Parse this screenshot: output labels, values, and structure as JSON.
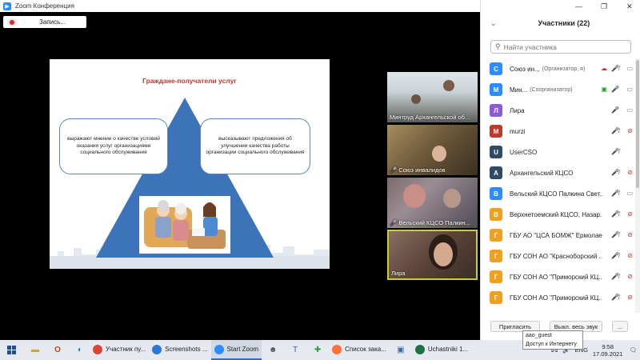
{
  "window": {
    "title": "Zoom Конференция"
  },
  "recording": {
    "label": "Запись..."
  },
  "slide": {
    "title": "Граждане-получатели услуг",
    "left_text": "выражают мнение о качестве условий оказания услуг организациями социального обслуживания",
    "right_text": "высказывают предложения об улучшении качества работы организации социального обслуживания"
  },
  "videos": [
    {
      "name": "Минтруд Архангельской об...",
      "muted": false
    },
    {
      "name": "Союз инвалидов",
      "muted": true
    },
    {
      "name": "Вельский КЦСО Палкин...",
      "muted": true
    },
    {
      "name": "Лира",
      "muted": false
    }
  ],
  "panel": {
    "title": "Участники (22)",
    "search_placeholder": "Найти участника",
    "participants": [
      {
        "initial": "С",
        "color": "#2d8cff",
        "name": "Союз ин...",
        "tag": "(Организатор, я)",
        "mic": "muted",
        "cam": "on",
        "extra": "cloud"
      },
      {
        "initial": "М",
        "color": "#2d8cff",
        "name": "Мин...",
        "tag": "(Соорганизатор)",
        "mic": "on",
        "cam": "on",
        "extra": "share"
      },
      {
        "initial": "Л",
        "color": "#8e5bd6",
        "name": "Лира",
        "tag": "",
        "mic": "on",
        "cam": "on",
        "extra": ""
      },
      {
        "initial": "M",
        "color": "#c0392b",
        "name": "murzi",
        "tag": "",
        "mic": "muted",
        "cam": "off",
        "extra": ""
      },
      {
        "initial": "U",
        "color": "#2f4b66",
        "name": "UserCSO",
        "tag": "",
        "mic": "muted",
        "cam": "",
        "extra": ""
      },
      {
        "initial": "А",
        "color": "#2f4b66",
        "name": "Архангельский КЦСО",
        "tag": "",
        "mic": "muted",
        "cam": "off",
        "extra": ""
      },
      {
        "initial": "В",
        "color": "#2d8cff",
        "name": "Вельский КЦСО Палкина Свет...",
        "tag": "",
        "mic": "muted",
        "cam": "on",
        "extra": ""
      },
      {
        "initial": "В",
        "color": "#f0a020",
        "name": "Верхнетоемский КЦСО, Назар...",
        "tag": "",
        "mic": "muted",
        "cam": "off",
        "extra": ""
      },
      {
        "initial": "Г",
        "color": "#f0a020",
        "name": "ГБУ АО \"ЦСА БОМЖ\" Ермолае...",
        "tag": "",
        "mic": "muted",
        "cam": "off",
        "extra": ""
      },
      {
        "initial": "Г",
        "color": "#f0a020",
        "name": "ГБУ СОН АО \"Красноборский ...",
        "tag": "",
        "mic": "muted",
        "cam": "off",
        "extra": ""
      },
      {
        "initial": "Г",
        "color": "#f0a020",
        "name": "ГБУ СОН АО \"Приморский КЦ...",
        "tag": "",
        "mic": "muted",
        "cam": "off",
        "extra": ""
      },
      {
        "initial": "Г",
        "color": "#f0a020",
        "name": "ГБУ СОН АО \"Приморский КЦ...",
        "tag": "",
        "mic": "muted",
        "cam": "off",
        "extra": ""
      }
    ],
    "invite_label": "Пригласить",
    "mute_all_label": "Выкл. весь звук",
    "more_label": "..."
  },
  "tooltip": {
    "line1": "aao_guest",
    "line2": "Доступ к Интернету"
  },
  "taskbar": {
    "apps": [
      {
        "label": "Участник пу...",
        "color": "#db4437",
        "active": false
      },
      {
        "label": "Screenshots ...",
        "color": "#2b79d6",
        "active": false
      },
      {
        "label": "Start Zoom",
        "color": "#2d8cff",
        "active": true
      },
      {
        "label": "Список зака...",
        "color": "#ff7139",
        "active": false
      },
      {
        "label": "Uchastniki 1...",
        "color": "#1f7244",
        "active": false
      }
    ],
    "lang": "ENG",
    "time": "9:58",
    "date": "17.09.2021"
  }
}
